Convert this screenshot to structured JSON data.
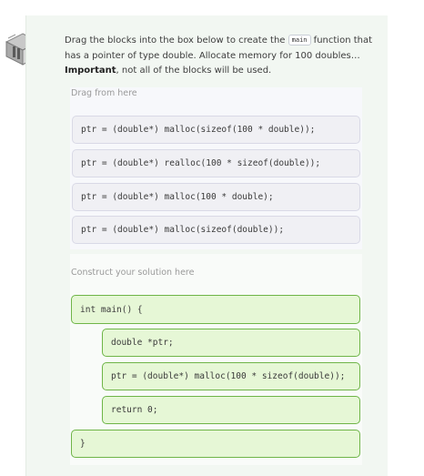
{
  "avatar": {
    "icon": "laptop-avatar-icon"
  },
  "instructions": {
    "part1": "Drag the blocks into the box below to create the ",
    "code": "main",
    "part2": " function that has a pointer of type double. Allocate memory for 100 doubles…",
    "important": "Important",
    "part3": ", not all of the blocks will be used."
  },
  "source": {
    "label": "Drag from here",
    "blocks": [
      "ptr = (double*) malloc(sizeof(100 * double));",
      "ptr = (double*) realloc(100 * sizeof(double));",
      "ptr = (double*) malloc(100 * double);",
      "ptr = (double*) malloc(sizeof(double));"
    ]
  },
  "solution": {
    "label": "Construct your solution here",
    "blocks": [
      "int main() {",
      "double *ptr;",
      "ptr = (double*) malloc(100 * sizeof(double));",
      "return 0;",
      "}"
    ]
  },
  "colors": {
    "card_bg": "#f2f7f2",
    "block_green_bg": "#e6f7d6",
    "block_green_border": "#6fb548",
    "block_source_bg": "#f0f0f4"
  }
}
